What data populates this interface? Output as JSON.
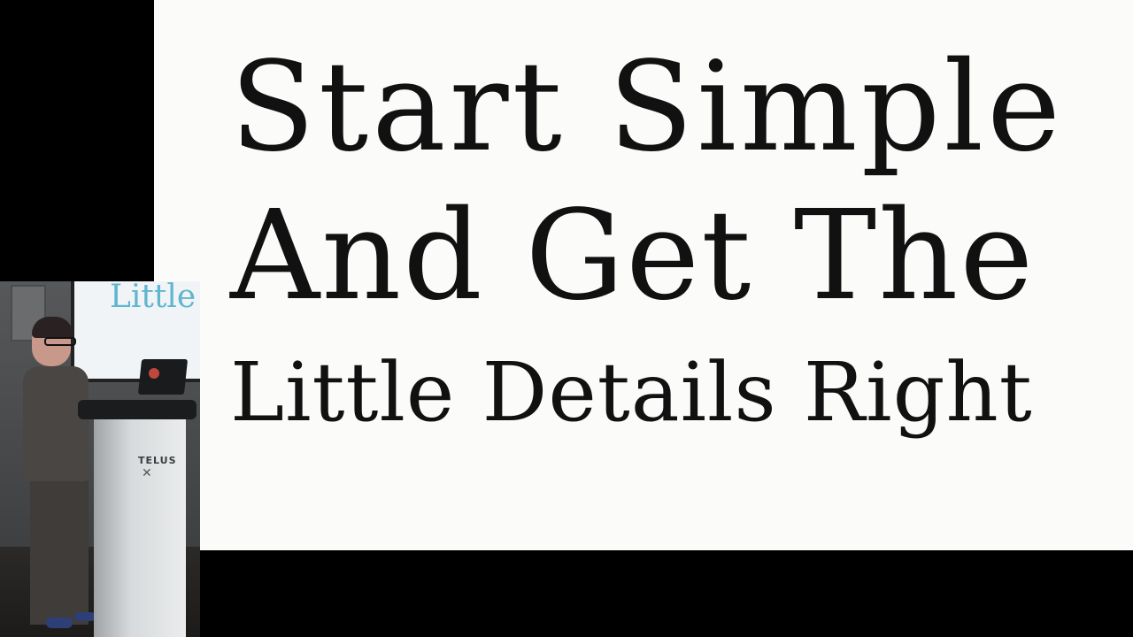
{
  "slide": {
    "lines": [
      "Start Simple",
      "And Get The",
      "Little Details Right"
    ]
  },
  "speaker_inset": {
    "screen_text": "Little",
    "podium_logo": "TELUS"
  },
  "colors": {
    "slide_background": "#fbfbf9",
    "slide_text": "#111111",
    "letterbox": "#000000",
    "inset_screen_text": "#5fb6cf"
  }
}
